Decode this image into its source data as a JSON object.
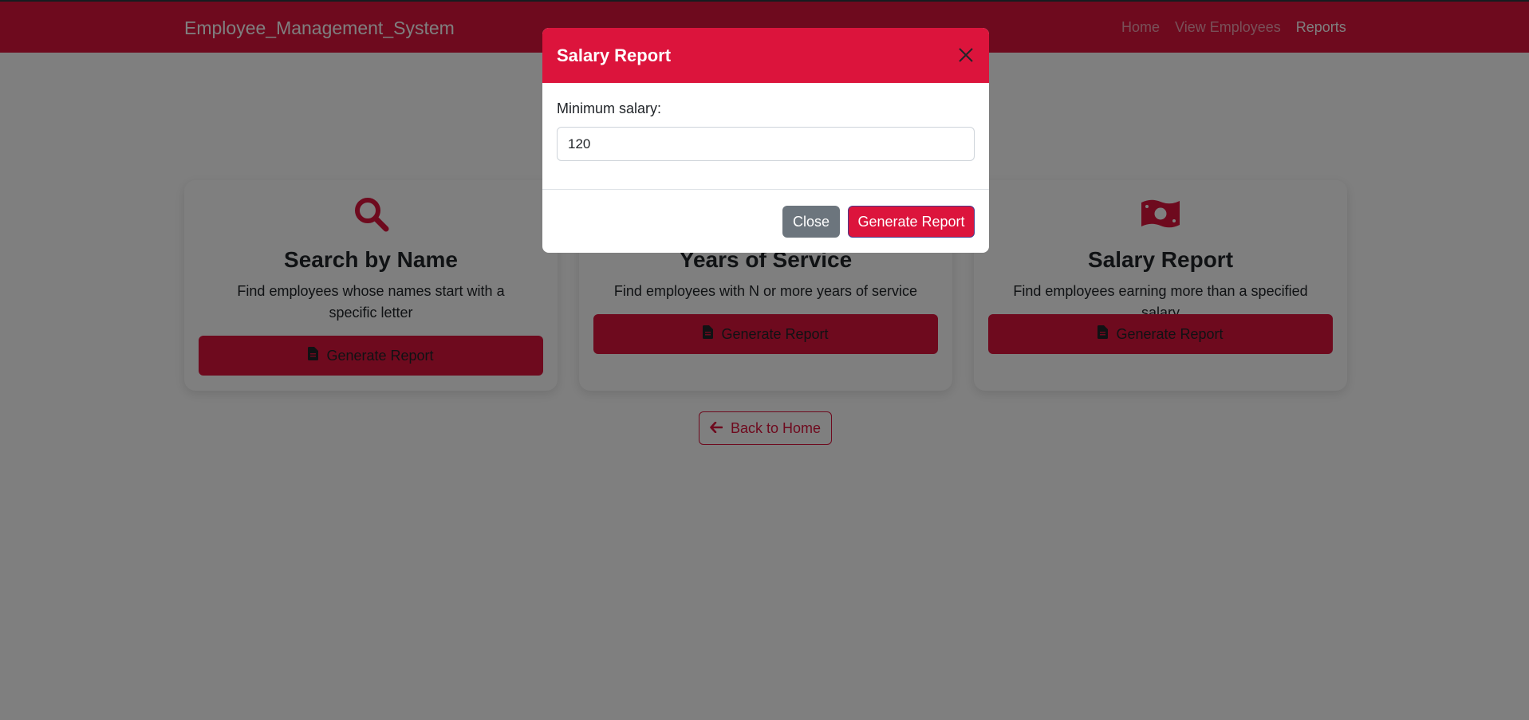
{
  "navbar": {
    "brand": "Employee_Management_System",
    "links": [
      {
        "label": "Home"
      },
      {
        "label": "View Employees"
      },
      {
        "label": "Reports"
      }
    ]
  },
  "cards": [
    {
      "icon": "search-icon",
      "title": "Search by Name",
      "description": "Find employees whose names start with a specific letter",
      "button_label": "Generate Report"
    },
    {
      "icon": "calendar-icon",
      "title": "Years of Service",
      "description": "Find employees with N or more years of service",
      "button_label": "Generate Report"
    },
    {
      "icon": "money-bill-icon",
      "title": "Salary Report",
      "description": "Find employees earning more than a specified salary",
      "button_label": "Generate Report"
    }
  ],
  "back_button": {
    "label": "Back to Home",
    "icon": "arrow-left-icon"
  },
  "modal": {
    "title": "Salary Report",
    "field_label": "Minimum salary:",
    "field_value": "120",
    "close_label": "Close",
    "generate_label": "Generate Report"
  },
  "colors": {
    "brand": "#dc143c",
    "secondary": "#6c757d",
    "backdrop": "rgba(0,0,0,0.5)"
  }
}
